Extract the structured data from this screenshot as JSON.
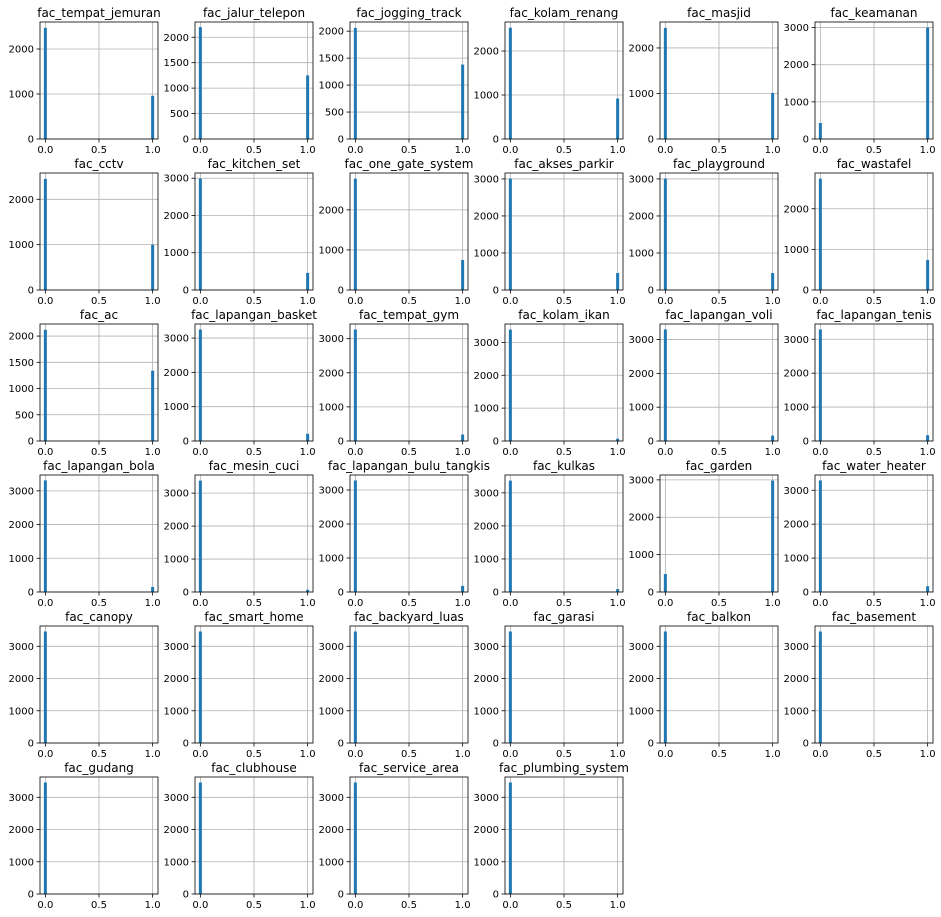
{
  "figure": {
    "bar_color": "#1f77b4",
    "grid": true
  },
  "chart_data": [
    {
      "type": "bar",
      "title": "fac_tempat_jemuran",
      "x": [
        0,
        1
      ],
      "values": [
        2470,
        960
      ],
      "xticks": [
        "0.0",
        "0.5",
        "1.0"
      ],
      "yticks": [
        "0",
        "1000",
        "2000"
      ],
      "ylim": [
        0,
        2600
      ],
      "xlim": [
        -0.05,
        1.05
      ]
    },
    {
      "type": "bar",
      "title": "fac_jalur_telepon",
      "x": [
        0,
        1
      ],
      "values": [
        2200,
        1250
      ],
      "xticks": [
        "0.0",
        "0.5",
        "1.0"
      ],
      "yticks": [
        "0",
        "500",
        "1000",
        "1500",
        "2000"
      ],
      "ylim": [
        0,
        2300
      ],
      "xlim": [
        -0.05,
        1.05
      ]
    },
    {
      "type": "bar",
      "title": "fac_jogging_track",
      "x": [
        0,
        1
      ],
      "values": [
        2060,
        1380
      ],
      "xticks": [
        "0.0",
        "0.5",
        "1.0"
      ],
      "yticks": [
        "0",
        "500",
        "1000",
        "1500",
        "2000"
      ],
      "ylim": [
        0,
        2170
      ],
      "xlim": [
        -0.05,
        1.05
      ]
    },
    {
      "type": "bar",
      "title": "fac_kolam_renang",
      "x": [
        0,
        1
      ],
      "values": [
        2530,
        920
      ],
      "xticks": [
        "0.0",
        "0.5",
        "1.0"
      ],
      "yticks": [
        "0",
        "1000",
        "2000"
      ],
      "ylim": [
        0,
        2660
      ],
      "xlim": [
        -0.05,
        1.05
      ]
    },
    {
      "type": "bar",
      "title": "fac_masjid",
      "x": [
        0,
        1
      ],
      "values": [
        2440,
        1010
      ],
      "xticks": [
        "0.0",
        "0.5",
        "1.0"
      ],
      "yticks": [
        "0",
        "1000",
        "2000"
      ],
      "ylim": [
        0,
        2570
      ],
      "xlim": [
        -0.05,
        1.05
      ]
    },
    {
      "type": "bar",
      "title": "fac_keamanan",
      "x": [
        0,
        1
      ],
      "values": [
        430,
        3000
      ],
      "xticks": [
        "0.0",
        "0.5",
        "1.0"
      ],
      "yticks": [
        "0",
        "1000",
        "2000",
        "3000"
      ],
      "ylim": [
        0,
        3150
      ],
      "xlim": [
        -0.05,
        1.05
      ]
    },
    {
      "type": "bar",
      "title": "fac_cctv",
      "x": [
        0,
        1
      ],
      "values": [
        2450,
        1000
      ],
      "xticks": [
        "0.0",
        "0.5",
        "1.0"
      ],
      "yticks": [
        "0",
        "1000",
        "2000"
      ],
      "ylim": [
        0,
        2580
      ],
      "xlim": [
        -0.05,
        1.05
      ]
    },
    {
      "type": "bar",
      "title": "fac_kitchen_set",
      "x": [
        0,
        1
      ],
      "values": [
        2990,
        460
      ],
      "xticks": [
        "0.0",
        "0.5",
        "1.0"
      ],
      "yticks": [
        "0",
        "1000",
        "2000",
        "3000"
      ],
      "ylim": [
        0,
        3140
      ],
      "xlim": [
        -0.05,
        1.05
      ]
    },
    {
      "type": "bar",
      "title": "fac_one_gate_system",
      "x": [
        0,
        1
      ],
      "values": [
        2780,
        750
      ],
      "xticks": [
        "0.0",
        "0.5",
        "1.0"
      ],
      "yticks": [
        "0",
        "1000",
        "2000"
      ],
      "ylim": [
        0,
        2920
      ],
      "xlim": [
        -0.05,
        1.05
      ]
    },
    {
      "type": "bar",
      "title": "fac_akses_parkir",
      "x": [
        0,
        1
      ],
      "values": [
        3010,
        460
      ],
      "xticks": [
        "0.0",
        "0.5",
        "1.0"
      ],
      "yticks": [
        "0",
        "1000",
        "2000",
        "3000"
      ],
      "ylim": [
        0,
        3160
      ],
      "xlim": [
        -0.05,
        1.05
      ]
    },
    {
      "type": "bar",
      "title": "fac_playground",
      "x": [
        0,
        1
      ],
      "values": [
        3010,
        460
      ],
      "xticks": [
        "0.0",
        "0.5",
        "1.0"
      ],
      "yticks": [
        "0",
        "1000",
        "2000",
        "3000"
      ],
      "ylim": [
        0,
        3160
      ],
      "xlim": [
        -0.05,
        1.05
      ]
    },
    {
      "type": "bar",
      "title": "fac_wastafel",
      "x": [
        0,
        1
      ],
      "values": [
        2740,
        740
      ],
      "xticks": [
        "0.0",
        "0.5",
        "1.0"
      ],
      "yticks": [
        "0",
        "1000",
        "2000"
      ],
      "ylim": [
        0,
        2880
      ],
      "xlim": [
        -0.05,
        1.05
      ]
    },
    {
      "type": "bar",
      "title": "fac_ac",
      "x": [
        0,
        1
      ],
      "values": [
        2120,
        1340
      ],
      "xticks": [
        "0.0",
        "0.5",
        "1.0"
      ],
      "yticks": [
        "0",
        "500",
        "1000",
        "1500",
        "2000"
      ],
      "ylim": [
        0,
        2230
      ],
      "xlim": [
        -0.05,
        1.05
      ]
    },
    {
      "type": "bar",
      "title": "fac_lapangan_basket",
      "x": [
        0,
        1
      ],
      "values": [
        3250,
        210
      ],
      "xticks": [
        "0.0",
        "0.5",
        "1.0"
      ],
      "yticks": [
        "0",
        "1000",
        "2000",
        "3000"
      ],
      "ylim": [
        0,
        3410
      ],
      "xlim": [
        -0.05,
        1.05
      ]
    },
    {
      "type": "bar",
      "title": "fac_tempat_gym",
      "x": [
        0,
        1
      ],
      "values": [
        3270,
        190
      ],
      "xticks": [
        "0.0",
        "0.5",
        "1.0"
      ],
      "yticks": [
        "0",
        "1000",
        "2000",
        "3000"
      ],
      "ylim": [
        0,
        3430
      ],
      "xlim": [
        -0.05,
        1.05
      ]
    },
    {
      "type": "bar",
      "title": "fac_kolam_ikan",
      "x": [
        0,
        1
      ],
      "values": [
        3390,
        70
      ],
      "xticks": [
        "0.0",
        "0.5",
        "1.0"
      ],
      "yticks": [
        "0",
        "1000",
        "2000",
        "3000"
      ],
      "ylim": [
        0,
        3560
      ],
      "xlim": [
        -0.05,
        1.05
      ]
    },
    {
      "type": "bar",
      "title": "fac_lapangan_voli",
      "x": [
        0,
        1
      ],
      "values": [
        3300,
        160
      ],
      "xticks": [
        "0.0",
        "0.5",
        "1.0"
      ],
      "yticks": [
        "0",
        "1000",
        "2000",
        "3000"
      ],
      "ylim": [
        0,
        3460
      ],
      "xlim": [
        -0.05,
        1.05
      ]
    },
    {
      "type": "bar",
      "title": "fac_lapangan_tenis",
      "x": [
        0,
        1
      ],
      "values": [
        3290,
        170
      ],
      "xticks": [
        "0.0",
        "0.5",
        "1.0"
      ],
      "yticks": [
        "0",
        "1000",
        "2000",
        "3000"
      ],
      "ylim": [
        0,
        3450
      ],
      "xlim": [
        -0.05,
        1.05
      ]
    },
    {
      "type": "bar",
      "title": "fac_lapangan_bola",
      "x": [
        0,
        1
      ],
      "values": [
        3310,
        150
      ],
      "xticks": [
        "0.0",
        "0.5",
        "1.0"
      ],
      "yticks": [
        "0",
        "1000",
        "2000",
        "3000"
      ],
      "ylim": [
        0,
        3470
      ],
      "xlim": [
        -0.05,
        1.05
      ]
    },
    {
      "type": "bar",
      "title": "fac_mesin_cuci",
      "x": [
        0,
        1
      ],
      "values": [
        3380,
        70
      ],
      "xticks": [
        "0.0",
        "0.5",
        "1.0"
      ],
      "yticks": [
        "0",
        "1000",
        "2000",
        "3000"
      ],
      "ylim": [
        0,
        3550
      ],
      "xlim": [
        -0.05,
        1.05
      ]
    },
    {
      "type": "bar",
      "title": "fac_lapangan_bulu_tangkis",
      "x": [
        0,
        1
      ],
      "values": [
        3280,
        180
      ],
      "xticks": [
        "0.0",
        "0.5",
        "1.0"
      ],
      "yticks": [
        "0",
        "1000",
        "2000",
        "3000"
      ],
      "ylim": [
        0,
        3440
      ],
      "xlim": [
        -0.05,
        1.05
      ]
    },
    {
      "type": "bar",
      "title": "fac_kulkas",
      "x": [
        0,
        1
      ],
      "values": [
        3370,
        90
      ],
      "xticks": [
        "0.0",
        "0.5",
        "1.0"
      ],
      "yticks": [
        "0",
        "1000",
        "2000",
        "3000"
      ],
      "ylim": [
        0,
        3540
      ],
      "xlim": [
        -0.05,
        1.05
      ]
    },
    {
      "type": "bar",
      "title": "fac_garden",
      "x": [
        0,
        1
      ],
      "values": [
        480,
        2980
      ],
      "xticks": [
        "0.0",
        "0.5",
        "1.0"
      ],
      "yticks": [
        "0",
        "1000",
        "2000",
        "3000"
      ],
      "ylim": [
        0,
        3130
      ],
      "xlim": [
        -0.05,
        1.05
      ]
    },
    {
      "type": "bar",
      "title": "fac_water_heater",
      "x": [
        0,
        1
      ],
      "values": [
        3290,
        170
      ],
      "xticks": [
        "0.0",
        "0.5",
        "1.0"
      ],
      "yticks": [
        "0",
        "1000",
        "2000",
        "3000"
      ],
      "ylim": [
        0,
        3450
      ],
      "xlim": [
        -0.05,
        1.05
      ]
    },
    {
      "type": "bar",
      "title": "fac_canopy",
      "x": [
        0,
        1
      ],
      "values": [
        3460,
        3
      ],
      "xticks": [
        "0.0",
        "0.5",
        "1.0"
      ],
      "yticks": [
        "0",
        "1000",
        "2000",
        "3000"
      ],
      "ylim": [
        0,
        3630
      ],
      "xlim": [
        -0.05,
        1.05
      ]
    },
    {
      "type": "bar",
      "title": "fac_smart_home",
      "x": [
        0,
        1
      ],
      "values": [
        3460,
        3
      ],
      "xticks": [
        "0.0",
        "0.5",
        "1.0"
      ],
      "yticks": [
        "0",
        "1000",
        "2000",
        "3000"
      ],
      "ylim": [
        0,
        3630
      ],
      "xlim": [
        -0.05,
        1.05
      ]
    },
    {
      "type": "bar",
      "title": "fac_backyard_luas",
      "x": [
        0,
        1
      ],
      "values": [
        3460,
        3
      ],
      "xticks": [
        "0.0",
        "0.5",
        "1.0"
      ],
      "yticks": [
        "0",
        "1000",
        "2000",
        "3000"
      ],
      "ylim": [
        0,
        3630
      ],
      "xlim": [
        -0.05,
        1.05
      ]
    },
    {
      "type": "bar",
      "title": "fac_garasi",
      "x": [
        0,
        1
      ],
      "values": [
        3460,
        3
      ],
      "xticks": [
        "0.0",
        "0.5",
        "1.0"
      ],
      "yticks": [
        "0",
        "1000",
        "2000",
        "3000"
      ],
      "ylim": [
        0,
        3630
      ],
      "xlim": [
        -0.05,
        1.05
      ]
    },
    {
      "type": "bar",
      "title": "fac_balkon",
      "x": [
        0,
        1
      ],
      "values": [
        3460,
        3
      ],
      "xticks": [
        "0.0",
        "0.5",
        "1.0"
      ],
      "yticks": [
        "0",
        "1000",
        "2000",
        "3000"
      ],
      "ylim": [
        0,
        3630
      ],
      "xlim": [
        -0.05,
        1.05
      ]
    },
    {
      "type": "bar",
      "title": "fac_basement",
      "x": [
        0,
        1
      ],
      "values": [
        3460,
        3
      ],
      "xticks": [
        "0.0",
        "0.5",
        "1.0"
      ],
      "yticks": [
        "0",
        "1000",
        "2000",
        "3000"
      ],
      "ylim": [
        0,
        3630
      ],
      "xlim": [
        -0.05,
        1.05
      ]
    },
    {
      "type": "bar",
      "title": "fac_gudang",
      "x": [
        0,
        1
      ],
      "values": [
        3460,
        3
      ],
      "xticks": [
        "0.0",
        "0.5",
        "1.0"
      ],
      "yticks": [
        "0",
        "1000",
        "2000",
        "3000"
      ],
      "ylim": [
        0,
        3630
      ],
      "xlim": [
        -0.05,
        1.05
      ]
    },
    {
      "type": "bar",
      "title": "fac_clubhouse",
      "x": [
        0,
        1
      ],
      "values": [
        3460,
        3
      ],
      "xticks": [
        "0.0",
        "0.5",
        "1.0"
      ],
      "yticks": [
        "0",
        "1000",
        "2000",
        "3000"
      ],
      "ylim": [
        0,
        3630
      ],
      "xlim": [
        -0.05,
        1.05
      ]
    },
    {
      "type": "bar",
      "title": "fac_service_area",
      "x": [
        0,
        1
      ],
      "values": [
        3460,
        3
      ],
      "xticks": [
        "0.0",
        "0.5",
        "1.0"
      ],
      "yticks": [
        "0",
        "1000",
        "2000",
        "3000"
      ],
      "ylim": [
        0,
        3630
      ],
      "xlim": [
        -0.05,
        1.05
      ]
    },
    {
      "type": "bar",
      "title": "fac_plumbing_system",
      "x": [
        0,
        1
      ],
      "values": [
        3460,
        3
      ],
      "xticks": [
        "0.0",
        "0.5",
        "1.0"
      ],
      "yticks": [
        "0",
        "1000",
        "2000",
        "3000"
      ],
      "ylim": [
        0,
        3630
      ],
      "xlim": [
        -0.05,
        1.05
      ]
    }
  ]
}
